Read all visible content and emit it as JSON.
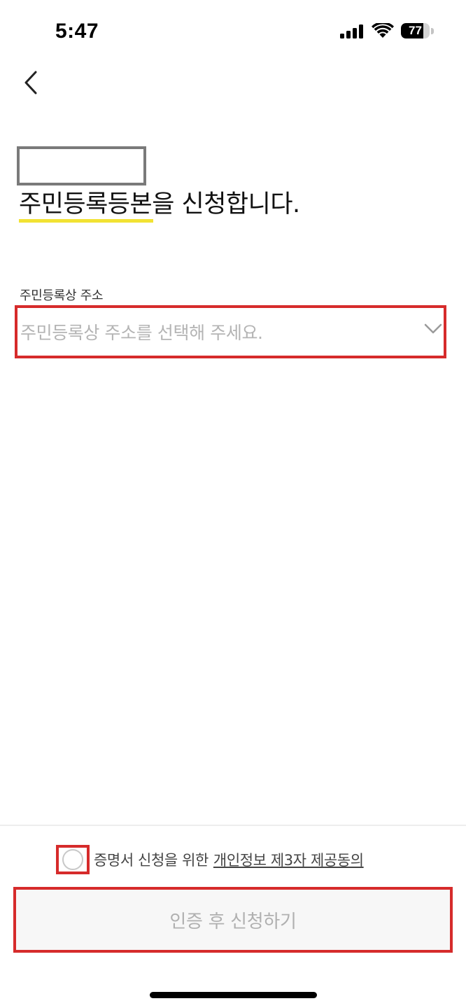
{
  "status_bar": {
    "time": "5:47",
    "battery_level": "77",
    "battery_fraction": 0.77,
    "signal_icon": "cellular-signal-icon",
    "wifi_icon": "wifi-icon"
  },
  "nav": {
    "back_icon": "chevron-left-icon"
  },
  "header": {
    "title_highlighted": "주민등록등본",
    "title_rest": "을 신청합니다.",
    "highlight_color": "#f2e233"
  },
  "address_field": {
    "label": "주민등록상 주소",
    "placeholder": "주민등록상 주소를 선택해 주세요.",
    "dropdown_icon": "chevron-down-icon"
  },
  "consent": {
    "checked": false,
    "text": "증명서 신청을 위한",
    "link_text": "개인정보 제3자 제공동의"
  },
  "submit": {
    "label": "인증 후 신청하기",
    "enabled": false
  },
  "colors": {
    "annotation_red": "#d62b2b",
    "placeholder_gray": "#b4b4b4",
    "button_bg": "#f7f7f7"
  }
}
